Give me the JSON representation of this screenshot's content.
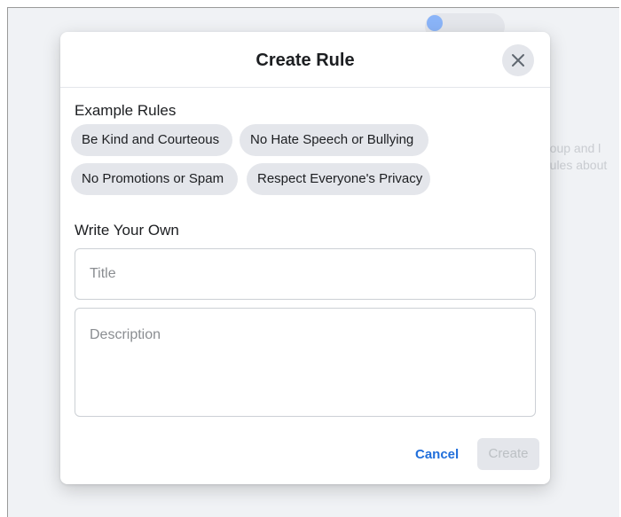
{
  "background": {
    "text_line_1": "roup and l",
    "text_line_2": "rules about"
  },
  "modal": {
    "title": "Create Rule",
    "close_icon": "close-icon",
    "example_section_label": "Example Rules",
    "example_rules": [
      "Be Kind and Courteous",
      "No Hate Speech or Bullying",
      "No Promotions or Spam",
      "Respect Everyone's Privacy"
    ],
    "write_section_label": "Write Your Own",
    "title_field": {
      "placeholder": "Title",
      "value": ""
    },
    "description_field": {
      "placeholder": "Description",
      "value": ""
    },
    "cancel_label": "Cancel",
    "create_label": "Create"
  },
  "colors": {
    "accent": "#216fdb",
    "chip_bg": "#e4e6eb",
    "disabled_text": "#bcc0c4"
  }
}
